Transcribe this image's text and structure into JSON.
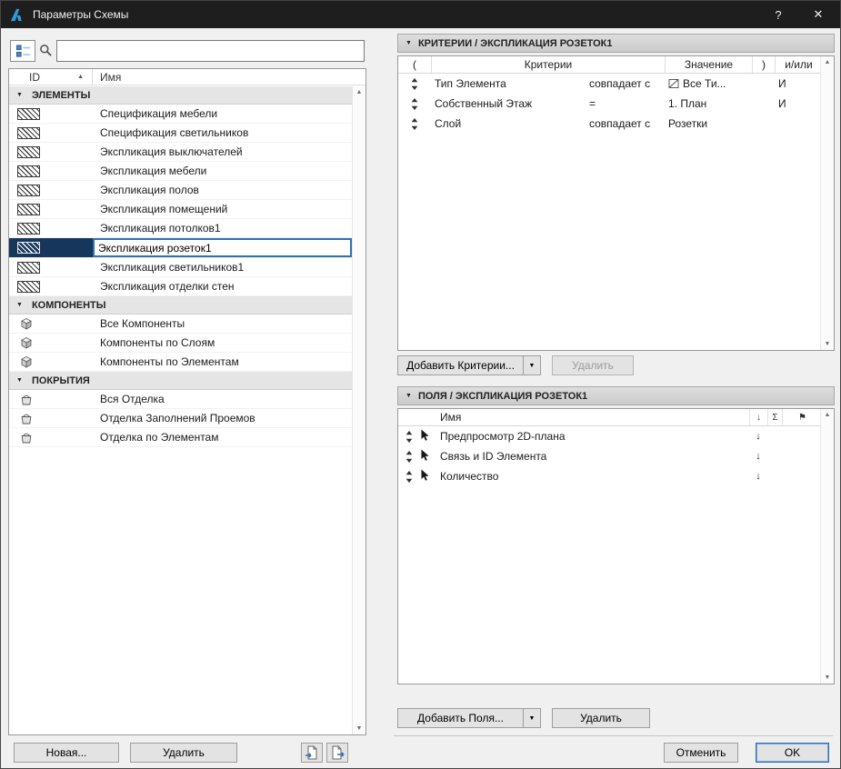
{
  "titlebar": {
    "title": "Параметры Схемы",
    "help": "?",
    "close": "✕"
  },
  "icons": {
    "collapse": "▼",
    "sort_asc": "▲",
    "sort_down": "↓",
    "sigma": "Σ",
    "flag": "⚑",
    "dropdown": "▼",
    "scroll_up": "▲",
    "scroll_down": "▼"
  },
  "left_panel": {
    "search": {
      "value": "",
      "placeholder": ""
    },
    "columns": {
      "id": "ID",
      "name": "Имя"
    },
    "groups": [
      {
        "label": "ЭЛЕМЕНТЫ",
        "items": [
          {
            "name": "Спецификация мебели"
          },
          {
            "name": "Спецификация светильников"
          },
          {
            "name": "Экспликация выключателей"
          },
          {
            "name": "Экспликация мебели"
          },
          {
            "name": "Экспликация полов"
          },
          {
            "name": "Экспликация помещений"
          },
          {
            "name": "Экспликация потолков1"
          },
          {
            "name": "Экспликация розеток1"
          },
          {
            "name": "Экспликация светильников1"
          },
          {
            "name": "Экспликация отделки стен"
          }
        ]
      },
      {
        "label": "КОМПОНЕНТЫ",
        "items": [
          {
            "name": "Все Компоненты"
          },
          {
            "name": "Компоненты по Слоям"
          },
          {
            "name": "Компоненты по Элементам"
          }
        ]
      },
      {
        "label": "ПОКРЫТИЯ",
        "items": [
          {
            "name": "Вся Отделка"
          },
          {
            "name": "Отделка Заполнений Проемов"
          },
          {
            "name": "Отделка по Элементам"
          }
        ]
      }
    ],
    "buttons": {
      "new": "Новая...",
      "delete": "Удалить"
    }
  },
  "criteria_panel": {
    "header": "КРИТЕРИИ /  ЭКСПЛИКАЦИЯ РОЗЕТОК1",
    "columns": {
      "open_paren": "(",
      "criteria": "Критерии",
      "value": "Значение",
      "close_paren": ")",
      "andor": "и/или"
    },
    "rows": [
      {
        "name": "Тип Элемента",
        "operator": "совпадает с",
        "value": "Все Ти...",
        "andor": "И"
      },
      {
        "name": "Собственный Этаж",
        "operator": "=",
        "value": "1. План",
        "andor": "И"
      },
      {
        "name": "Слой",
        "operator": "совпадает с",
        "value": "Розетки",
        "andor": ""
      }
    ],
    "add_button": "Добавить Критерии...",
    "delete_button": "Удалить"
  },
  "fields_panel": {
    "header": "ПОЛЯ /  ЭКСПЛИКАЦИЯ РОЗЕТОК1",
    "columns": {
      "name": "Имя"
    },
    "rows": [
      {
        "name": "Предпросмотр 2D-плана"
      },
      {
        "name": "Связь и ID Элемента"
      },
      {
        "name": "Количество"
      }
    ],
    "add_button": "Добавить Поля...",
    "delete_button": "Удалить"
  },
  "footer": {
    "cancel": "Отменить",
    "ok": "OK"
  }
}
